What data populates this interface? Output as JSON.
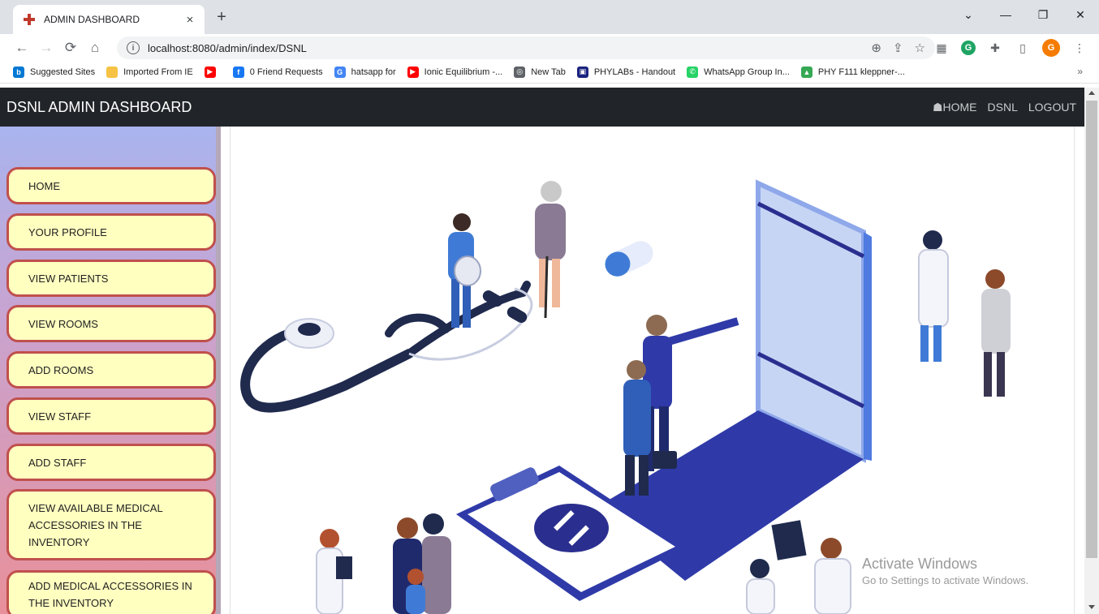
{
  "browser": {
    "tab_title": "ADMIN DASHBOARD",
    "tab_close": "×",
    "new_tab": "+",
    "window_controls": [
      "⌄",
      "—",
      "❐",
      "✕"
    ],
    "url": "localhost:8080/admin/index/DSNL",
    "bookmarks": [
      {
        "label": "Suggested Sites",
        "icon": "bing-icon",
        "color": "#0078d4",
        "glyph": "b"
      },
      {
        "label": "Imported From IE",
        "icon": "folder-icon",
        "color": "#f6c344",
        "glyph": ""
      },
      {
        "label": "",
        "icon": "youtube-icon",
        "color": "#ff0000",
        "glyph": "▶"
      },
      {
        "label": "0 Friend Requests",
        "icon": "facebook-icon",
        "color": "#1877f2",
        "glyph": "f"
      },
      {
        "label": "hatsapp for",
        "icon": "google-icon",
        "color": "#4285f4",
        "glyph": "G"
      },
      {
        "label": "Ionic Equilibrium -...",
        "icon": "youtube-icon",
        "color": "#ff0000",
        "glyph": "▶"
      },
      {
        "label": "New Tab",
        "icon": "globe-icon",
        "color": "#5f6368",
        "glyph": "◎"
      },
      {
        "label": "PHYLABs - Handout",
        "icon": "bits-icon",
        "color": "#1a237e",
        "glyph": "▣"
      },
      {
        "label": "WhatsApp Group In...",
        "icon": "whatsapp-icon",
        "color": "#25d366",
        "glyph": "✆"
      },
      {
        "label": "PHY F111 kleppner-...",
        "icon": "drive-icon",
        "color": "#34a853",
        "glyph": "▲"
      }
    ],
    "bookmarks_more": "»",
    "avatar_letter": "G",
    "grammarly_letter": "G"
  },
  "navbar": {
    "brand": "DSNL ADMIN DASHBOARD",
    "links": [
      "HOME",
      "DSNL",
      "LOGOUT"
    ]
  },
  "sidebar": {
    "items": [
      {
        "label": "HOME"
      },
      {
        "label": "YOUR PROFILE"
      },
      {
        "label": "VIEW PATIENTS"
      },
      {
        "label": "VIEW ROOMS"
      },
      {
        "label": "ADD ROOMS"
      },
      {
        "label": "VIEW STAFF"
      },
      {
        "label": "ADD STAFF"
      },
      {
        "label": "VIEW AVAILABLE MEDICAL ACCESSORIES IN THE INVENTORY"
      },
      {
        "label": "ADD MEDICAL ACCESSORIES IN THE INVENTORY"
      }
    ]
  },
  "watermark": {
    "title": "Activate Windows",
    "subtitle": "Go to Settings to activate Windows."
  },
  "colors": {
    "navbar_bg": "#212529",
    "menu_button_bg": "#ffffc0",
    "menu_button_border": "#c0504d",
    "illustration_primary": "#2f3aa8",
    "illustration_dark": "#1f2a4d"
  }
}
